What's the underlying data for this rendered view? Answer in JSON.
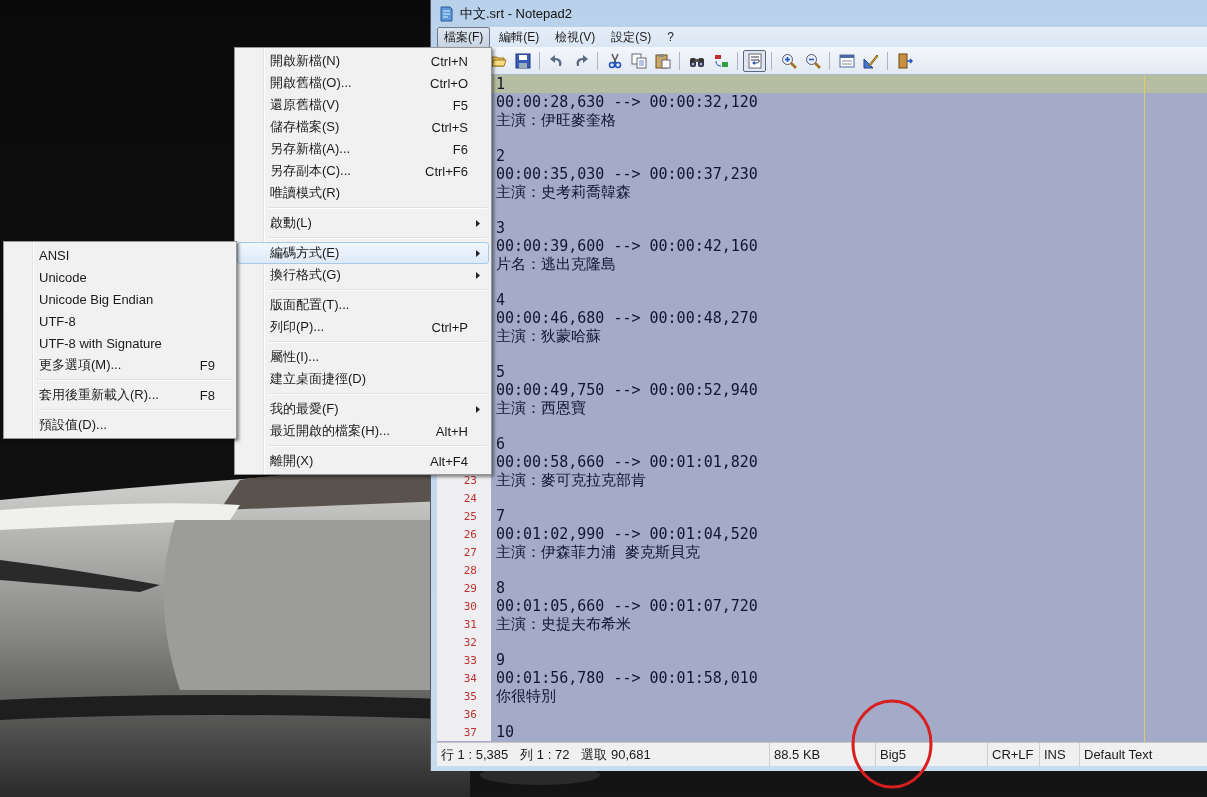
{
  "window": {
    "title": "中文.srt - Notepad2"
  },
  "menu_bar": [
    {
      "label": "檔案(F)",
      "selected": true
    },
    {
      "label": "編輯(E)",
      "selected": false
    },
    {
      "label": "檢視(V)",
      "selected": false
    },
    {
      "label": "設定(S)",
      "selected": false
    },
    {
      "label": "?",
      "selected": false
    }
  ],
  "toolbar": [
    [
      {
        "kind": "open",
        "pressed": false
      },
      {
        "kind": "save",
        "pressed": false
      }
    ],
    [
      {
        "kind": "undo",
        "pressed": false
      },
      {
        "kind": "redo",
        "pressed": false
      }
    ],
    [
      {
        "kind": "cut",
        "pressed": false
      },
      {
        "kind": "copy",
        "pressed": false
      },
      {
        "kind": "paste",
        "pressed": false
      }
    ],
    [
      {
        "kind": "find",
        "pressed": false
      },
      {
        "kind": "replace",
        "pressed": false
      }
    ],
    [
      {
        "kind": "wrap",
        "pressed": true
      }
    ],
    [
      {
        "kind": "zoom_in",
        "pressed": false
      },
      {
        "kind": "zoom_out",
        "pressed": false
      }
    ],
    [
      {
        "kind": "view",
        "pressed": false
      },
      {
        "kind": "ruler",
        "pressed": false
      }
    ],
    [
      {
        "kind": "exit",
        "pressed": false
      }
    ]
  ],
  "editor": {
    "lines": [
      {
        "text": "1",
        "current": true
      },
      {
        "text": "00:00:28,630 --> 00:00:32,120",
        "current": false
      },
      {
        "text": "主演：伊旺麥奎格",
        "current": false
      },
      {
        "current": false
      },
      {
        "text": "2",
        "current": false
      },
      {
        "text": "00:00:35,030 --> 00:00:37,230",
        "current": false
      },
      {
        "text": "主演：史考莉喬韓森",
        "current": false
      },
      {
        "current": false
      },
      {
        "text": "3",
        "current": false
      },
      {
        "text": "00:00:39,600 --> 00:00:42,160",
        "current": false
      },
      {
        "text": "片名：逃出克隆島",
        "current": false
      },
      {
        "current": false
      },
      {
        "text": "4",
        "current": false
      },
      {
        "text": "00:00:46,680 --> 00:00:48,270",
        "current": false
      },
      {
        "text": "主演：狄蒙哈蘇",
        "current": false
      },
      {
        "current": false
      },
      {
        "text": "5",
        "current": false
      },
      {
        "text": "00:00:49,750 --> 00:00:52,940",
        "current": false
      },
      {
        "text": "主演：西恩寶",
        "current": false
      },
      {
        "current": false
      },
      {
        "text": "6",
        "current": false
      },
      {
        "text": "00:00:58,660 --> 00:01:01,820",
        "current": false
      },
      {
        "number": "23",
        "text": "主演：麥可克拉克部肯",
        "current": false
      },
      {
        "number": "24",
        "current": false
      },
      {
        "number": "25",
        "text": "7",
        "current": false
      },
      {
        "number": "26",
        "text": "00:01:02,990 --> 00:01:04,520",
        "current": false
      },
      {
        "number": "27",
        "text": "主演：伊森菲力浦 麥克斯貝克",
        "current": false
      },
      {
        "number": "28",
        "current": false
      },
      {
        "number": "29",
        "text": "8",
        "current": false
      },
      {
        "number": "30",
        "text": "00:01:05,660 --> 00:01:07,720",
        "current": false
      },
      {
        "number": "31",
        "text": "主演：史提夫布希米",
        "current": false
      },
      {
        "number": "32",
        "current": false
      },
      {
        "number": "33",
        "text": "9",
        "current": false
      },
      {
        "number": "34",
        "text": "00:01:56,780 --> 00:01:58,010",
        "current": false
      },
      {
        "number": "35",
        "text": "你很特別",
        "current": false
      },
      {
        "number": "36",
        "current": false
      },
      {
        "number": "37",
        "text": "10",
        "current": false
      }
    ]
  },
  "status_bar": {
    "position": [
      "行 1 : 5,385",
      "列 1 : 72",
      "選取 90,681"
    ],
    "size": "88.5 KB",
    "encoding": "Big5",
    "line_ending": "CR+LF",
    "mode": "INS",
    "lexer": "Default Text"
  },
  "file_menu": {
    "groups": [
      [
        {
          "label": "開啟新檔(N)",
          "shortcut": "Ctrl+N",
          "submenu": false,
          "selected": false
        },
        {
          "label": "開啟舊檔(O)...",
          "shortcut": "Ctrl+O",
          "submenu": false,
          "selected": false
        },
        {
          "label": "還原舊檔(V)",
          "shortcut": "F5",
          "submenu": false,
          "selected": false
        },
        {
          "label": "儲存檔案(S)",
          "shortcut": "Ctrl+S",
          "submenu": false,
          "selected": false
        },
        {
          "label": "另存新檔(A)...",
          "shortcut": "F6",
          "submenu": false,
          "selected": false
        },
        {
          "label": "另存副本(C)...",
          "shortcut": "Ctrl+F6",
          "submenu": false,
          "selected": false
        },
        {
          "label": "唯讀模式(R)",
          "submenu": false,
          "selected": false
        }
      ],
      [
        {
          "label": "啟動(L)",
          "submenu": true,
          "selected": false
        }
      ],
      [
        {
          "label": "編碼方式(E)",
          "submenu": true,
          "selected": true
        },
        {
          "label": "換行格式(G)",
          "submenu": true,
          "selected": false
        }
      ],
      [
        {
          "label": "版面配置(T)...",
          "submenu": false,
          "selected": false
        },
        {
          "label": "列印(P)...",
          "shortcut": "Ctrl+P",
          "submenu": false,
          "selected": false
        }
      ],
      [
        {
          "label": "屬性(I)...",
          "submenu": false,
          "selected": false
        },
        {
          "label": "建立桌面捷徑(D)",
          "submenu": false,
          "selected": false
        }
      ],
      [
        {
          "label": "我的最愛(F)",
          "submenu": true,
          "selected": false
        },
        {
          "label": "最近開啟的檔案(H)...",
          "shortcut": "Alt+H",
          "submenu": false,
          "selected": false
        }
      ],
      [
        {
          "label": "離開(X)",
          "shortcut": "Alt+F4",
          "submenu": false,
          "selected": false
        }
      ]
    ]
  },
  "encoding_menu": {
    "groups": [
      [
        {
          "label": "ANSI",
          "selected": false
        },
        {
          "label": "Unicode",
          "selected": false
        },
        {
          "label": "Unicode Big Endian",
          "selected": false
        },
        {
          "label": "UTF-8",
          "selected": false
        },
        {
          "label": "UTF-8 with Signature",
          "selected": false
        },
        {
          "label": "更多選項(M)...",
          "shortcut": "F9",
          "selected": false
        }
      ],
      [
        {
          "label": "套用後重新載入(R)...",
          "shortcut": "F8",
          "selected": false
        }
      ],
      [
        {
          "label": "預設值(D)...",
          "selected": false
        }
      ]
    ]
  }
}
